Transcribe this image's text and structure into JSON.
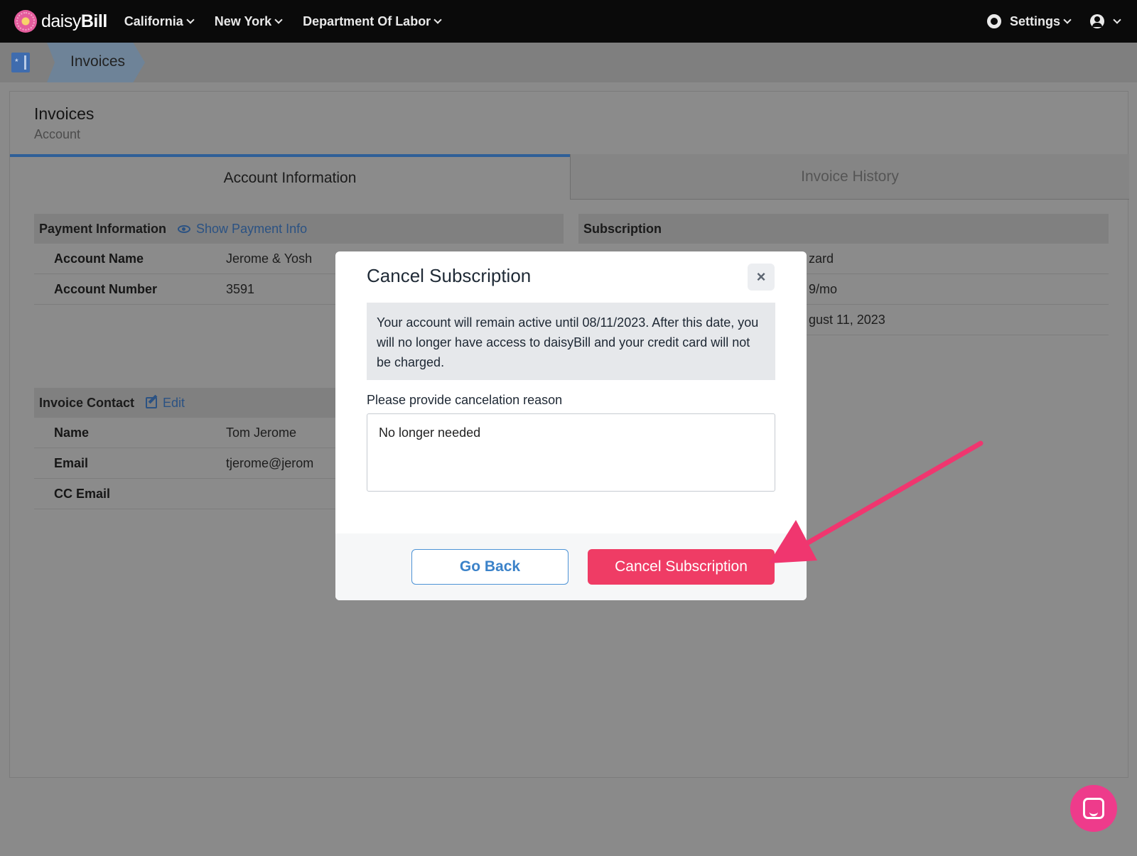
{
  "topnav": {
    "logo_prefix": "daisy",
    "logo_suffix": "Bill",
    "items": [
      {
        "label": "California"
      },
      {
        "label": "New York"
      },
      {
        "label": "Department Of Labor"
      }
    ],
    "settings_label": "Settings"
  },
  "breadcrumb": {
    "home_glyph": "*",
    "current": "Invoices"
  },
  "page": {
    "title": "Invoices",
    "subtitle": "Account"
  },
  "tabs": [
    {
      "label": "Account Information",
      "active": true
    },
    {
      "label": "Invoice History",
      "active": false
    }
  ],
  "payment": {
    "header": "Payment Information",
    "link_label": "Show Payment Info",
    "rows": [
      {
        "label": "Account Name",
        "value": "Jerome & Yosh"
      },
      {
        "label": "Account Number",
        "value": "3591"
      }
    ]
  },
  "subscription": {
    "header": "Subscription",
    "rows": [
      {
        "value": "zard"
      },
      {
        "value": "9/mo"
      },
      {
        "value": "gust 11, 2023"
      }
    ]
  },
  "contact": {
    "header": "Invoice Contact",
    "link_label": "Edit",
    "rows": [
      {
        "label": "Name",
        "value": "Tom Jerome"
      },
      {
        "label": "Email",
        "value": "tjerome@jerom"
      },
      {
        "label": "CC Email",
        "value": ""
      }
    ]
  },
  "modal": {
    "title": "Cancel Subscription",
    "close_glyph": "×",
    "notice": "Your account will remain active until 08/11/2023. After this date, you will no longer have access to daisyBill and your credit card will not be charged.",
    "reason_label": "Please provide cancelation reason",
    "reason_value": "No longer needed",
    "back_label": "Go Back",
    "confirm_label": "Cancel Subscription"
  },
  "colors": {
    "accent_blue": "#3b82c9",
    "danger": "#ef3c65",
    "annotation_arrow": "#f0366f",
    "chat": "#ee3b8b"
  },
  "icons": {
    "logo": "daisy-flower-icon",
    "settings": "gear-icon",
    "account": "user-circle-icon",
    "show_payment": "eye-icon",
    "edit": "pencil-icon",
    "close": "close-icon",
    "chat": "chat-icon"
  }
}
